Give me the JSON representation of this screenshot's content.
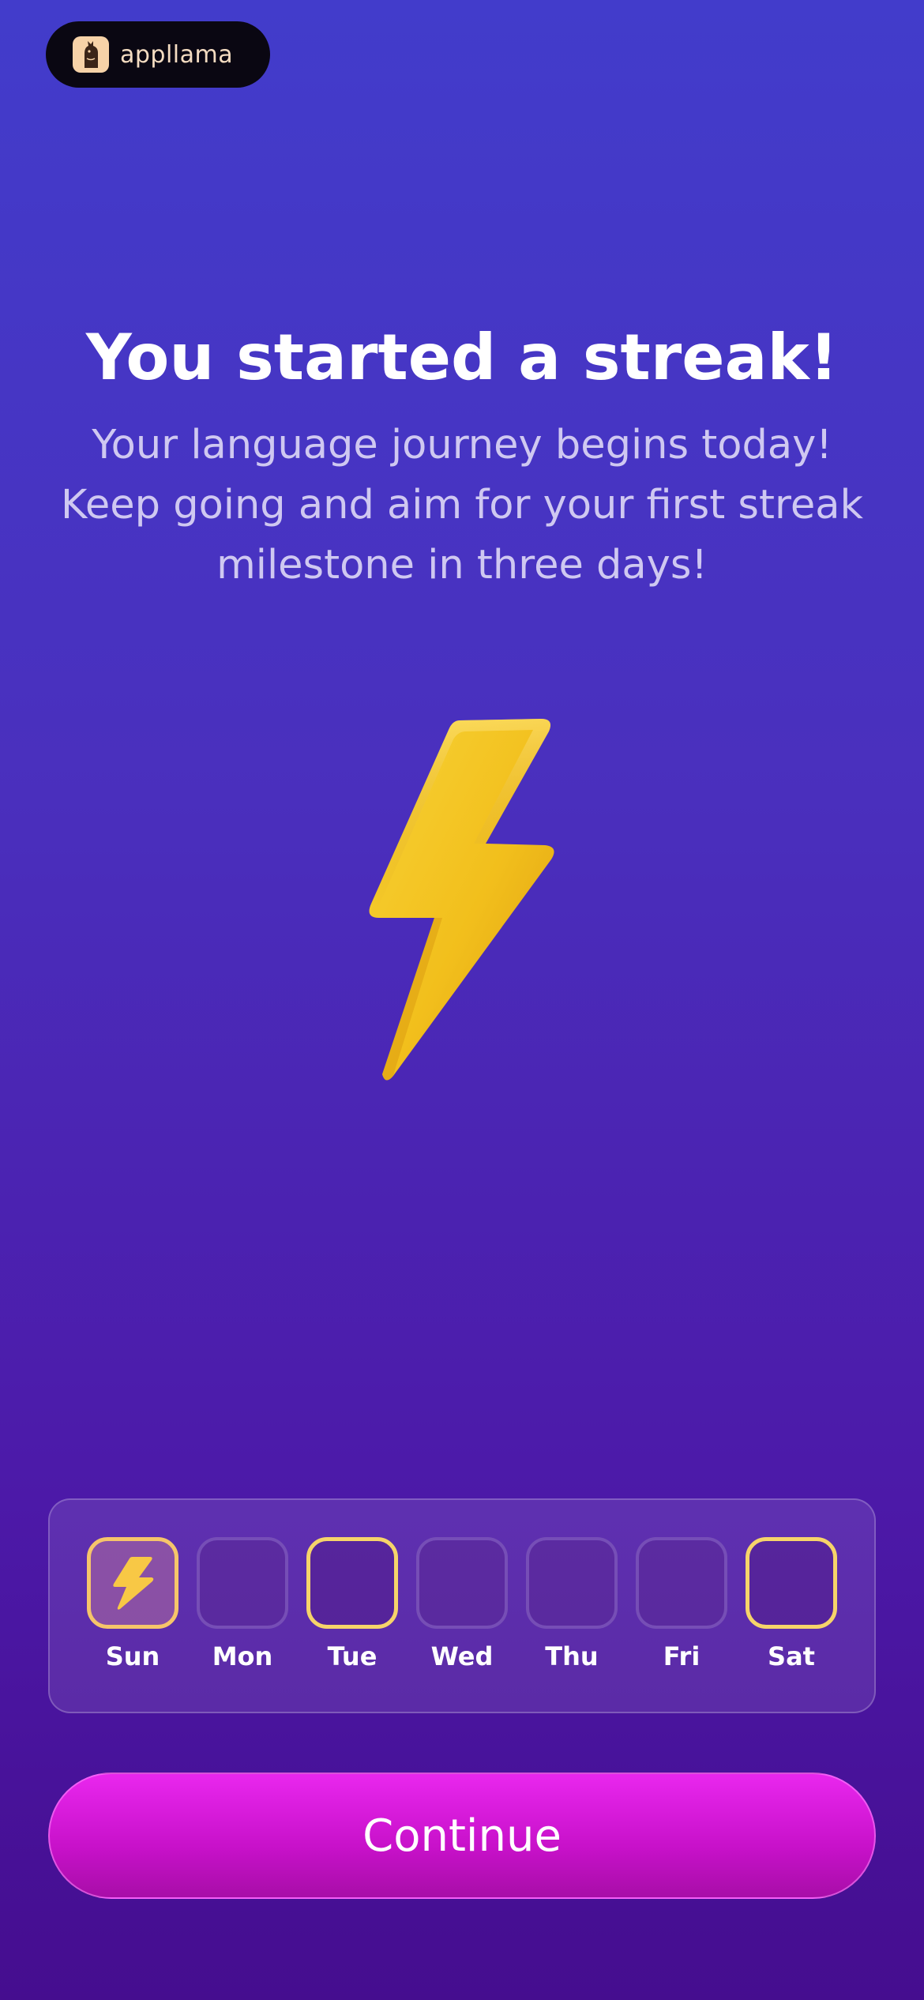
{
  "brand": {
    "name": "appllama",
    "logo_icon": "llama-icon"
  },
  "hero": {
    "title": "You started a streak!",
    "subtitle": "Your language journey begins today! Keep going and aim for your first streak milestone in three days!",
    "illustration_icon": "lightning-bolt-icon"
  },
  "week": {
    "days": [
      {
        "label": "Sun",
        "state": "completed"
      },
      {
        "label": "Mon",
        "state": "empty"
      },
      {
        "label": "Tue",
        "state": "goal"
      },
      {
        "label": "Wed",
        "state": "empty"
      },
      {
        "label": "Thu",
        "state": "empty"
      },
      {
        "label": "Fri",
        "state": "empty"
      },
      {
        "label": "Sat",
        "state": "goal"
      }
    ]
  },
  "actions": {
    "continue_label": "Continue"
  },
  "colors": {
    "accent_magenta": "#e927ee",
    "bolt_yellow": "#f6c82a",
    "goal_outline": "#f6d46a",
    "background_top": "#423ccb",
    "background_bottom": "#450d8f"
  }
}
